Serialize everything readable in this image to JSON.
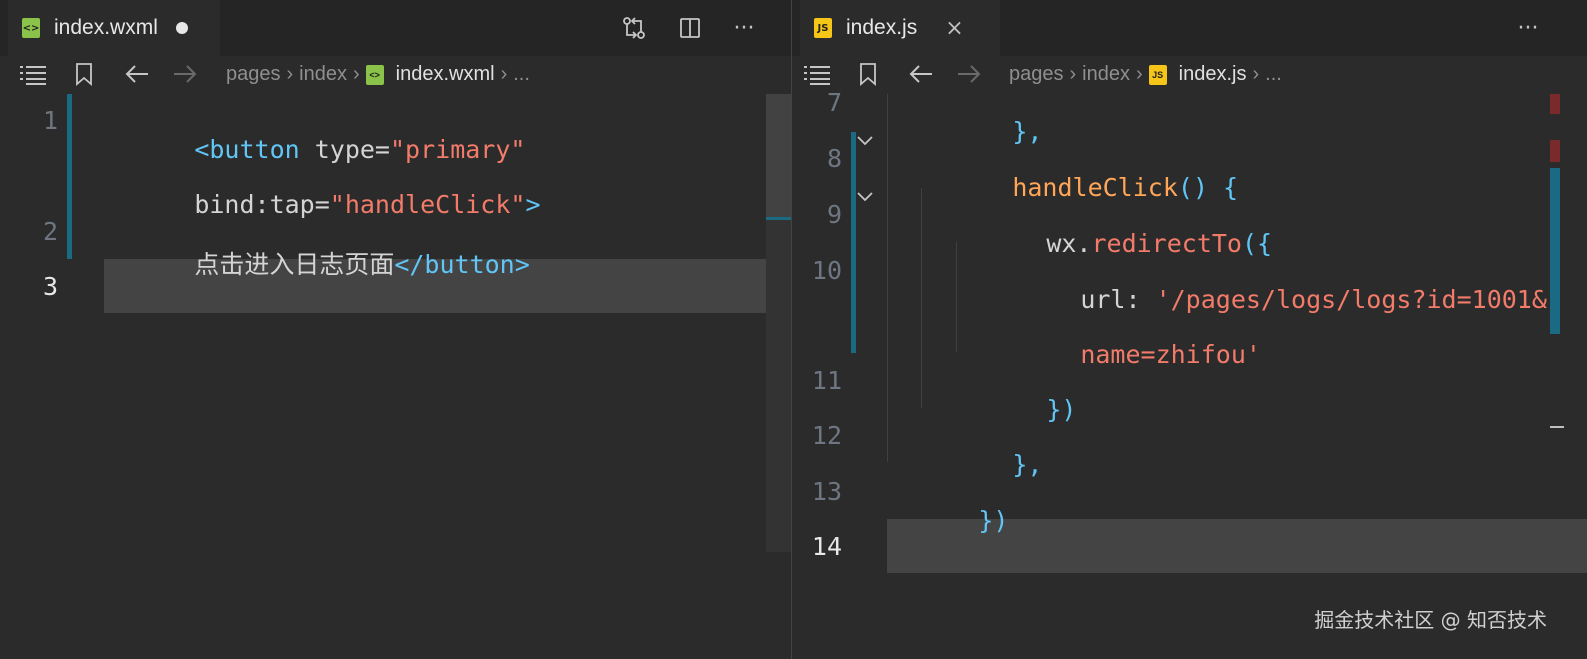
{
  "left_editor": {
    "tab": {
      "icon": "wxml-file-icon",
      "icon_label": "<>",
      "label": "index.wxml",
      "unsaved": true
    },
    "actions": {
      "compare_icon": "compare-changes-icon",
      "split_icon": "split-editor-icon",
      "more_label": "···"
    },
    "breadcrumb": {
      "path": [
        "pages",
        "index"
      ],
      "file": "index.wxml",
      "tail": "...",
      "file_icon_label": "<>"
    },
    "line_numbers": [
      "1",
      "2",
      "3"
    ],
    "lines": [
      {
        "parts": [
          "<button",
          " type=",
          "\"primary\""
        ]
      },
      {
        "parts": [
          "bind:tap=",
          "\"handleClick\"",
          ">"
        ]
      },
      {
        "parts": [
          "点击进入日志页面",
          "</button>"
        ]
      }
    ]
  },
  "right_editor": {
    "tab": {
      "icon": "js-file-icon",
      "icon_label": "JS",
      "label": "index.js",
      "close_label": "×"
    },
    "actions": {
      "more_label": "···"
    },
    "breadcrumb": {
      "path": [
        "pages",
        "index"
      ],
      "file": "index.js",
      "tail": "...",
      "file_icon_label": "JS"
    },
    "line_numbers": [
      "7",
      "8",
      "9",
      "10",
      "11",
      "12",
      "13",
      "14"
    ],
    "lines": {
      "l7": "},",
      "l8_fn": "handleClick",
      "l8_rest": "() {",
      "l9_obj": "wx.",
      "l9_method": "redirectTo",
      "l9_paren": "({",
      "l10_key": "url: ",
      "l10_str": "'/pages/logs/logs?id=1001&",
      "l10b_str": "name=zhifou'",
      "l11": "})",
      "l12": "},",
      "l13": "})"
    }
  },
  "breadcrumb_icons": {
    "outline": "list-icon",
    "bookmark": "bookmark-icon",
    "back": "arrow-left-icon",
    "forward": "arrow-right-icon"
  },
  "watermark": "掘金技术社区 @ 知否技术",
  "colors": {
    "tag": "#61c5f5",
    "string": "#f27b6a",
    "function": "#ffa657",
    "git_bar": "#1b6a84",
    "current_line": "#444444"
  }
}
